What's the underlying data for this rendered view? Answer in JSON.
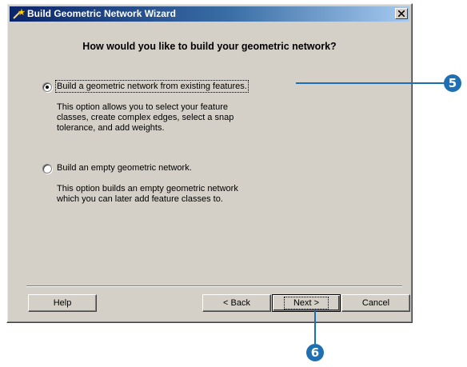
{
  "window": {
    "title": "Build Geometric Network Wizard",
    "close_glyph": "×"
  },
  "heading": "How would you like to build your geometric network?",
  "options": [
    {
      "label": "Build a geometric network from existing features.",
      "selected": true,
      "description": [
        "This option allows you to select your feature",
        "classes, create complex edges, select a snap",
        "tolerance, and add weights."
      ]
    },
    {
      "label": "Build an empty geometric network.",
      "selected": false,
      "description": [
        "This option builds an empty geometric network",
        "which you can later add feature classes to."
      ]
    }
  ],
  "buttons": {
    "help": "Help",
    "back": "< Back",
    "next": "Next >",
    "cancel": "Cancel"
  },
  "callouts": {
    "step5": "5",
    "step6": "6"
  },
  "colors": {
    "titlebar_start": "#0a246a",
    "titlebar_end": "#a6caf0",
    "dialog_bg": "#d4d0c8",
    "callout_blue": "#1f6fb3"
  }
}
